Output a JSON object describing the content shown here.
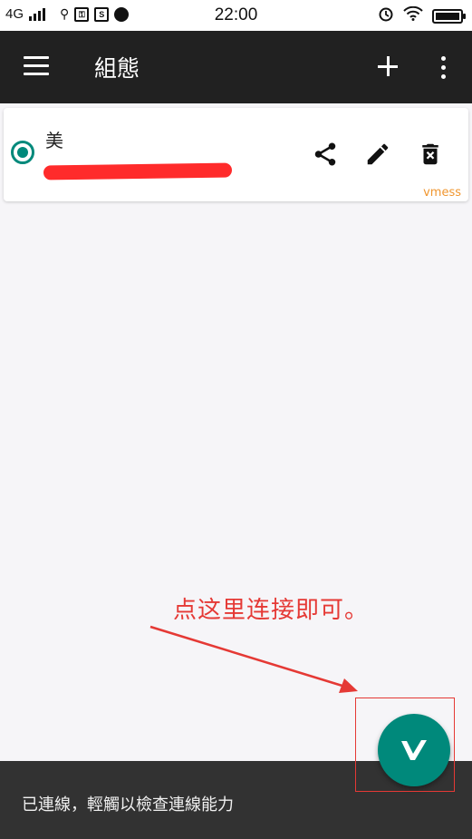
{
  "status_bar": {
    "network": "4G",
    "time": "22:00"
  },
  "app_bar": {
    "title": "組態"
  },
  "server": {
    "name": "美",
    "type": "vmess"
  },
  "annotation": {
    "text": "点这里连接即可。"
  },
  "bottom_bar": {
    "status": "已連線，輕觸以檢查連線能力"
  },
  "colors": {
    "accent": "#00897b",
    "appbar": "#212121",
    "annotation": "#e53935",
    "type_badge": "#f0962f"
  }
}
